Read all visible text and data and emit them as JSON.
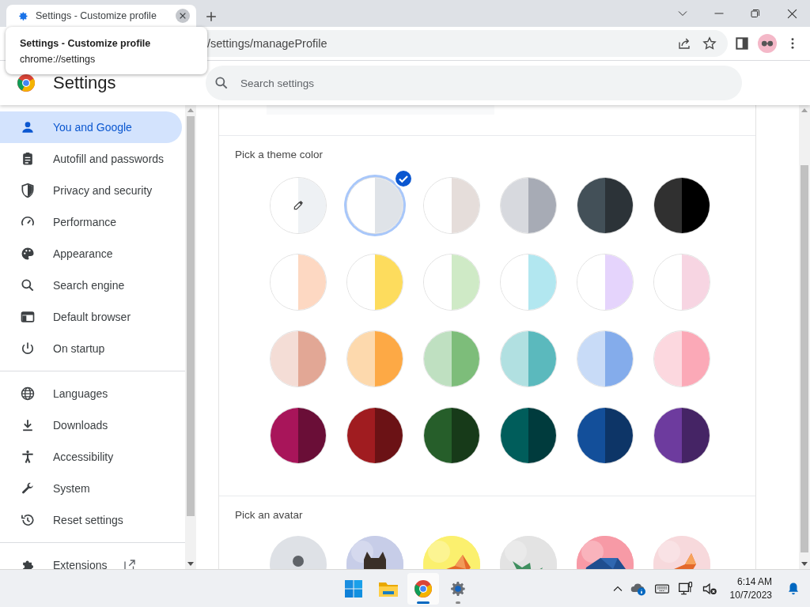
{
  "tab_strip": {
    "tabs": [
      {
        "title": "Settings - Customize profile",
        "selected": true
      }
    ]
  },
  "tooltip": {
    "title": "Settings - Customize profile",
    "url": "chrome://settings"
  },
  "address_bar": {
    "value": "/settings/manageProfile"
  },
  "header": {
    "title": "Settings",
    "search": {
      "placeholder": "Search settings"
    }
  },
  "sidebar": {
    "groups": [
      [
        {
          "label": "You and Google",
          "selected": true
        },
        {
          "label": "Autofill and passwords",
          "selected": false
        },
        {
          "label": "Privacy and security",
          "selected": false
        },
        {
          "label": "Performance",
          "selected": false
        },
        {
          "label": "Appearance",
          "selected": false
        },
        {
          "label": "Search engine",
          "selected": false
        },
        {
          "label": "Default browser",
          "selected": false
        },
        {
          "label": "On startup",
          "selected": false
        }
      ],
      [
        {
          "label": "Languages",
          "selected": false
        },
        {
          "label": "Downloads",
          "selected": false
        },
        {
          "label": "Accessibility",
          "selected": false
        },
        {
          "label": "System",
          "selected": false
        },
        {
          "label": "Reset settings",
          "selected": false
        }
      ],
      [
        {
          "label": "Extensions",
          "selected": false
        }
      ]
    ]
  },
  "theme_section": {
    "title": "Pick a theme color",
    "colors": [
      {
        "kind": "custom",
        "halves": [
          {
            "color": "#ffffff"
          },
          {
            "color": "#eef1f4"
          }
        ],
        "selected": false
      },
      {
        "kind": "swatch",
        "halves": [
          {
            "color": "#ffffff"
          },
          {
            "color": "#dfe3e8"
          }
        ],
        "selected": true
      },
      {
        "kind": "swatch",
        "halves": [
          {
            "color": "#ffffff"
          },
          {
            "color": "#e5ddda"
          }
        ],
        "selected": false
      },
      {
        "kind": "swatch",
        "halves": [
          {
            "color": "#d7d9de"
          },
          {
            "color": "#a7abb5"
          }
        ],
        "selected": false
      },
      {
        "kind": "swatch",
        "halves": [
          {
            "color": "#435058"
          },
          {
            "color": "#2c3338"
          }
        ],
        "selected": false
      },
      {
        "kind": "swatch",
        "halves": [
          {
            "color": "#303030"
          },
          {
            "color": "#000000"
          }
        ],
        "selected": false
      },
      {
        "kind": "swatch",
        "halves": [
          {
            "color": "#ffffff"
          },
          {
            "color": "#fdd8c2"
          }
        ],
        "selected": false
      },
      {
        "kind": "swatch",
        "halves": [
          {
            "color": "#ffffff"
          },
          {
            "color": "#fddc5d"
          }
        ],
        "selected": false
      },
      {
        "kind": "swatch",
        "halves": [
          {
            "color": "#ffffff"
          },
          {
            "color": "#cfeac6"
          }
        ],
        "selected": false
      },
      {
        "kind": "swatch",
        "halves": [
          {
            "color": "#ffffff"
          },
          {
            "color": "#b2e7f0"
          }
        ],
        "selected": false
      },
      {
        "kind": "swatch",
        "halves": [
          {
            "color": "#ffffff"
          },
          {
            "color": "#e5d4fc"
          }
        ],
        "selected": false
      },
      {
        "kind": "swatch",
        "halves": [
          {
            "color": "#ffffff"
          },
          {
            "color": "#f7d5e2"
          }
        ],
        "selected": false
      },
      {
        "kind": "swatch",
        "halves": [
          {
            "color": "#f4ddd6"
          },
          {
            "color": "#e2a795"
          }
        ],
        "selected": false
      },
      {
        "kind": "swatch",
        "halves": [
          {
            "color": "#fdd9ad"
          },
          {
            "color": "#fda945"
          }
        ],
        "selected": false
      },
      {
        "kind": "swatch",
        "halves": [
          {
            "color": "#bfe0c1"
          },
          {
            "color": "#7dbd7a"
          }
        ],
        "selected": false
      },
      {
        "kind": "swatch",
        "halves": [
          {
            "color": "#b1e0e1"
          },
          {
            "color": "#5bb9bd"
          }
        ],
        "selected": false
      },
      {
        "kind": "swatch",
        "halves": [
          {
            "color": "#c8dbf7"
          },
          {
            "color": "#84aceb"
          }
        ],
        "selected": false
      },
      {
        "kind": "swatch",
        "halves": [
          {
            "color": "#fcd8df"
          },
          {
            "color": "#fba9b7"
          }
        ],
        "selected": false
      },
      {
        "kind": "swatch",
        "halves": [
          {
            "color": "#a8155a"
          },
          {
            "color": "#6a0e37"
          }
        ],
        "selected": false
      },
      {
        "kind": "swatch",
        "halves": [
          {
            "color": "#a01c20"
          },
          {
            "color": "#6b1215"
          }
        ],
        "selected": false
      },
      {
        "kind": "swatch",
        "halves": [
          {
            "color": "#265e2a"
          },
          {
            "color": "#173a19"
          }
        ],
        "selected": false
      },
      {
        "kind": "swatch",
        "halves": [
          {
            "color": "#005d5b"
          },
          {
            "color": "#003b3d"
          }
        ],
        "selected": false
      },
      {
        "kind": "swatch",
        "halves": [
          {
            "color": "#134f9a"
          },
          {
            "color": "#0d3567"
          }
        ],
        "selected": false
      },
      {
        "kind": "swatch",
        "halves": [
          {
            "color": "#6d3b9e"
          },
          {
            "color": "#452465"
          }
        ],
        "selected": false
      }
    ]
  },
  "avatar_section": {
    "title": "Pick an avatar",
    "avatars": [
      {
        "kind": "silhouette",
        "color": "#dee1e6",
        "selected": false
      },
      {
        "kind": "picture",
        "color": "#c7cde8",
        "selected": false
      },
      {
        "kind": "picture",
        "color": "#fbf06e",
        "selected": false
      },
      {
        "kind": "picture",
        "color": "#e3e3e3",
        "selected": false
      },
      {
        "kind": "picture",
        "color": "#f79aa6",
        "selected": false
      },
      {
        "kind": "picture",
        "color": "#f7d9dc",
        "selected": false
      }
    ]
  },
  "taskbar": {
    "apps": [
      {
        "selected": false,
        "running": false
      },
      {
        "selected": false,
        "running": false
      },
      {
        "selected": true,
        "running": true
      },
      {
        "selected": false,
        "running": true
      }
    ],
    "time": "6:14 AM",
    "date": "10/7/2023"
  }
}
